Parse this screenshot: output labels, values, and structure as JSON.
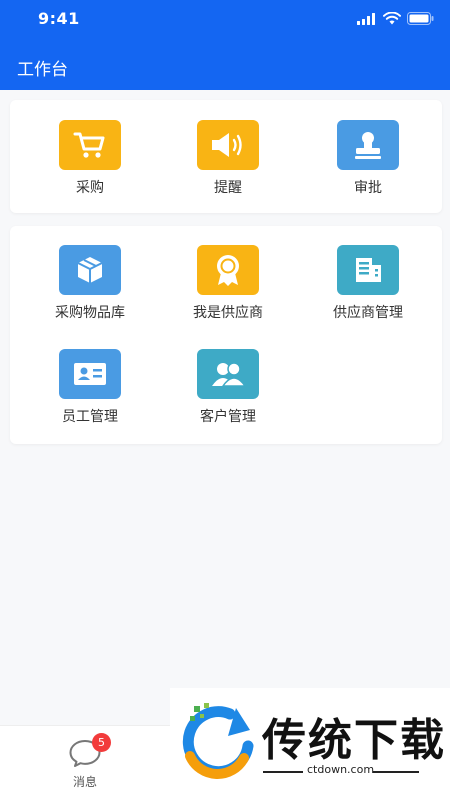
{
  "status_bar": {
    "time": "9:41"
  },
  "header": {
    "title": "工作台"
  },
  "section_one": {
    "items": [
      {
        "label": "采购",
        "icon": "shopping-cart-icon",
        "color": "#f9b414"
      },
      {
        "label": "提醒",
        "icon": "speaker-icon",
        "color": "#f9b414"
      },
      {
        "label": "审批",
        "icon": "stamp-icon",
        "color": "#4a9be3"
      }
    ]
  },
  "section_two": {
    "items": [
      {
        "label": "采购物品库",
        "icon": "box-icon",
        "color": "#4a9be3"
      },
      {
        "label": "我是供应商",
        "icon": "badge-ribbon-icon",
        "color": "#f9b414"
      },
      {
        "label": "供应商管理",
        "icon": "building-icon",
        "color": "#3eaac6"
      },
      {
        "label": "员工管理",
        "icon": "id-card-icon",
        "color": "#4a9be3"
      },
      {
        "label": "客户管理",
        "icon": "users-icon",
        "color": "#3eaac6"
      }
    ]
  },
  "tab_bar": {
    "message_label": "消息",
    "message_badge": "5"
  },
  "watermark": {
    "text": "传统下载",
    "url": "ctdown.com"
  },
  "colors": {
    "header_bg": "#1466f2",
    "badge_bg": "#f23b3b"
  }
}
